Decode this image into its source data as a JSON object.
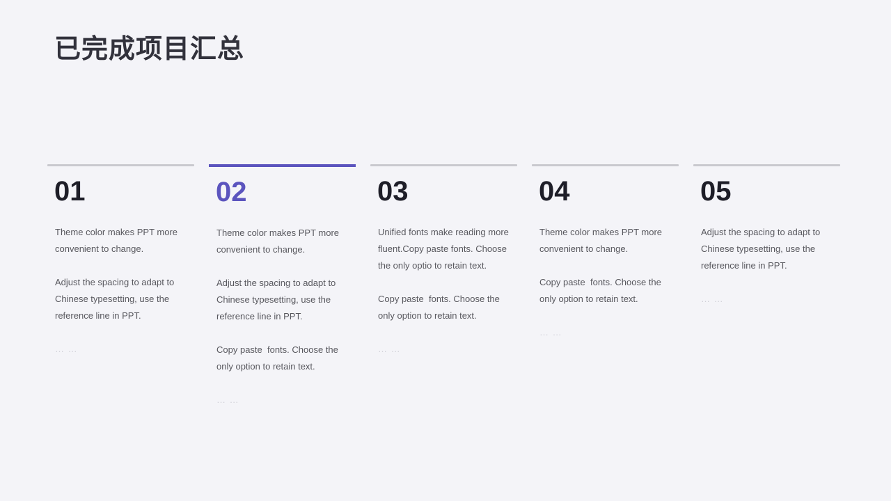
{
  "slide": {
    "title": "已完成项目汇总",
    "background_color": "#f4f4f8",
    "accent_color": "#5b54be",
    "bar_color": "#c9c9cf",
    "number_color": "#1e1e28",
    "body_text_color": "#58585e",
    "ellipsis_color": "#cfcfd6"
  },
  "columns": [
    {
      "number": "01",
      "active": false,
      "paragraphs": [
        "Theme color makes PPT more convenient to change.",
        "Adjust the spacing to adapt to Chinese typesetting, use the reference line in PPT.",
        "… …"
      ]
    },
    {
      "number": "02",
      "active": true,
      "paragraphs": [
        "Theme color makes PPT more convenient to change.",
        "Adjust the spacing to adapt to Chinese typesetting, use the reference line in PPT.",
        "Copy paste  fonts. Choose the only option to retain text.",
        "… …"
      ]
    },
    {
      "number": "03",
      "active": false,
      "paragraphs": [
        "Unified fonts make reading more fluent.Copy paste fonts. Choose the only optio to retain text.",
        "Copy paste  fonts. Choose the only option to retain text.",
        "… …"
      ]
    },
    {
      "number": "04",
      "active": false,
      "paragraphs": [
        "Theme color makes PPT more convenient to change.",
        "Copy paste  fonts. Choose the only option to retain text.",
        "… …"
      ]
    },
    {
      "number": "05",
      "active": false,
      "paragraphs": [
        "Adjust the spacing to adapt to Chinese typesetting, use the reference line in PPT.",
        "… …"
      ]
    }
  ]
}
